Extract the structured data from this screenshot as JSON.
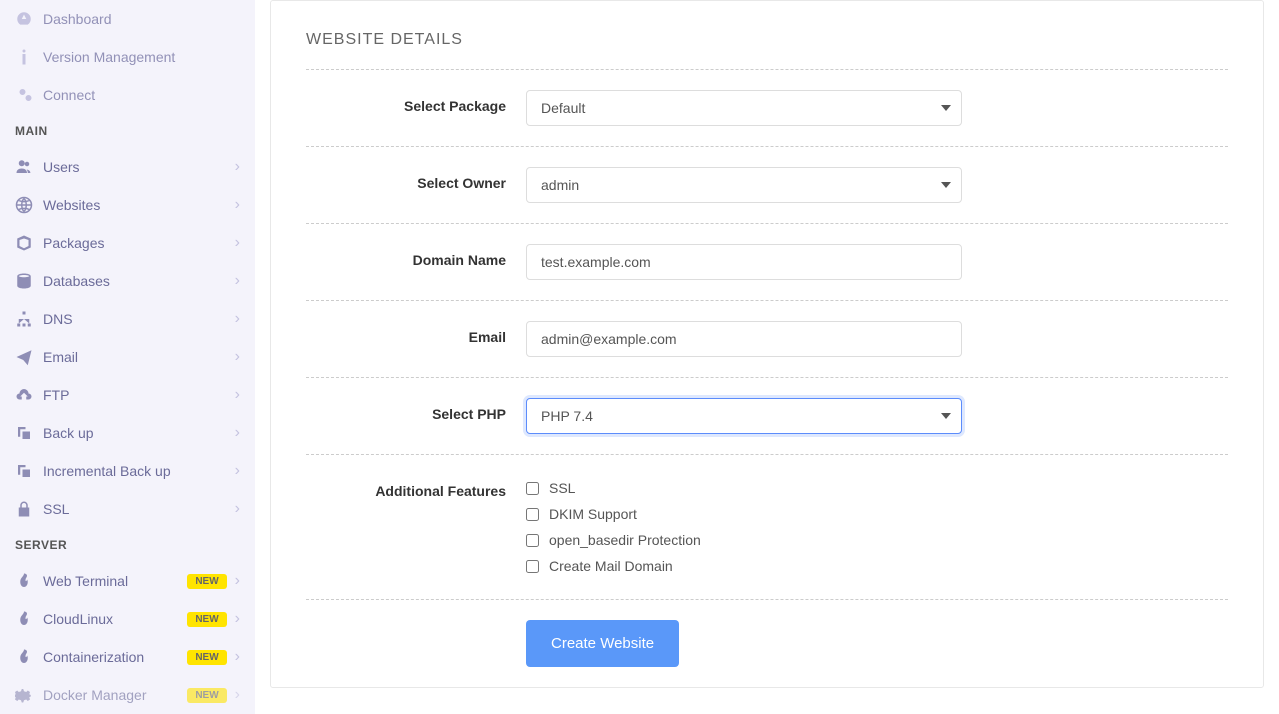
{
  "sidebar": {
    "top": [
      {
        "label": "Dashboard",
        "icon": "dashboard"
      },
      {
        "label": "Version Management",
        "icon": "info"
      },
      {
        "label": "Connect",
        "icon": "connect"
      }
    ],
    "section_main": "MAIN",
    "main": [
      {
        "label": "Users",
        "icon": "users"
      },
      {
        "label": "Websites",
        "icon": "globe"
      },
      {
        "label": "Packages",
        "icon": "packages"
      },
      {
        "label": "Databases",
        "icon": "database"
      },
      {
        "label": "DNS",
        "icon": "sitemap"
      },
      {
        "label": "Email",
        "icon": "plane"
      },
      {
        "label": "FTP",
        "icon": "cloud-up"
      },
      {
        "label": "Back up",
        "icon": "copy"
      },
      {
        "label": "Incremental Back up",
        "icon": "copy"
      },
      {
        "label": "SSL",
        "icon": "lock"
      }
    ],
    "section_server": "SERVER",
    "server": [
      {
        "label": "Web Terminal",
        "icon": "fire",
        "badge": "NEW"
      },
      {
        "label": "CloudLinux",
        "icon": "fire",
        "badge": "NEW"
      },
      {
        "label": "Containerization",
        "icon": "fire",
        "badge": "NEW"
      },
      {
        "label": "Docker Manager",
        "icon": "gear",
        "badge": "NEW"
      }
    ]
  },
  "card": {
    "title": "WEBSITE DETAILS",
    "fields": {
      "package_label": "Select Package",
      "package_value": "Default",
      "owner_label": "Select Owner",
      "owner_value": "admin",
      "domain_label": "Domain Name",
      "domain_value": "test.example.com",
      "email_label": "Email",
      "email_value": "admin@example.com",
      "php_label": "Select PHP",
      "php_value": "PHP 7.4",
      "features_label": "Additional Features",
      "features": [
        "SSL",
        "DKIM Support",
        "open_basedir Protection",
        "Create Mail Domain"
      ],
      "submit_label": "Create Website"
    }
  }
}
